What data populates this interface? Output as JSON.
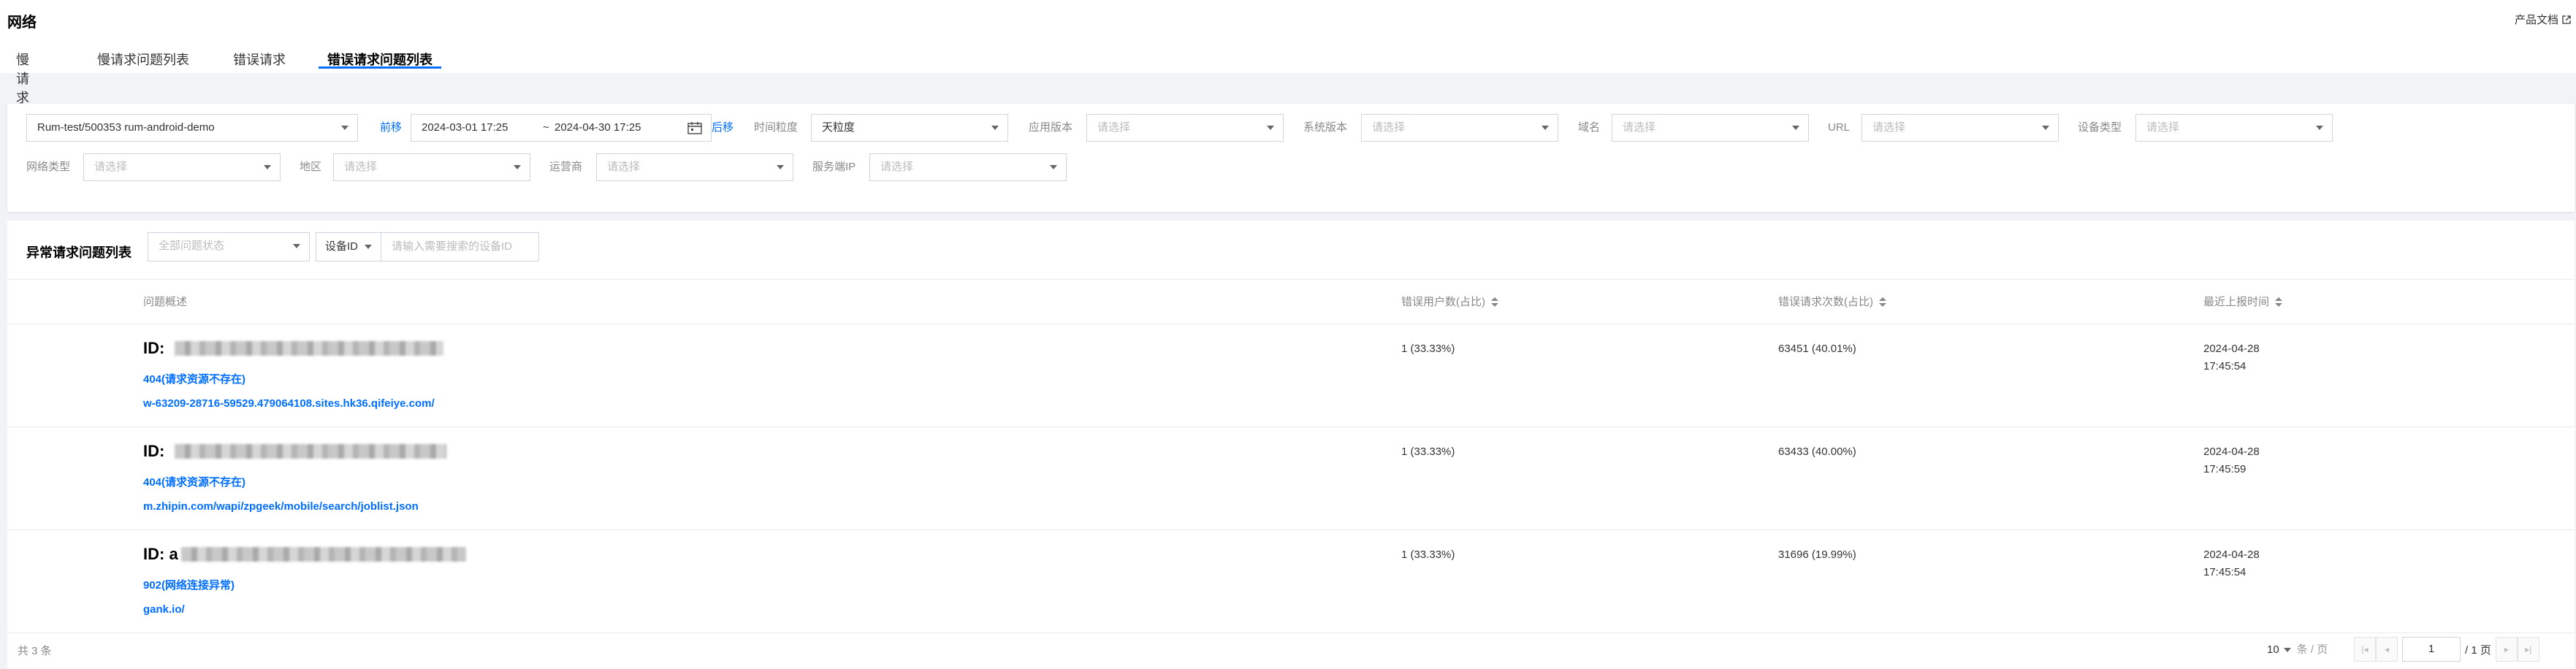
{
  "header": {
    "title": "网络",
    "doc_link": "产品文档"
  },
  "tabs": [
    {
      "label": "慢请求",
      "active": false
    },
    {
      "label": "慢请求问题列表",
      "active": false
    },
    {
      "label": "错误请求",
      "active": false
    },
    {
      "label": "错误请求问题列表",
      "active": true
    }
  ],
  "filters": {
    "project_value": "Rum-test/500353 rum-android-demo",
    "prev_label": "前移",
    "date_from": "2024-03-01 17:25",
    "date_sep": "~",
    "date_to": "2024-04-30 17:25",
    "next_label": "后移",
    "granularity_label": "时间粒度",
    "granularity_value": "天粒度",
    "app_version_label": "应用版本",
    "os_version_label": "系统版本",
    "domain_label": "域名",
    "url_label": "URL",
    "device_type_label": "设备类型",
    "network_type_label": "网络类型",
    "region_label": "地区",
    "carrier_label": "运营商",
    "server_ip_label": "服务端IP",
    "placeholder": "请选择"
  },
  "list": {
    "title": "异常请求问题列表",
    "status_placeholder": "全部问题状态",
    "search_key": "设备ID",
    "search_placeholder": "请输入需要搜索的设备ID",
    "columns": {
      "desc": "问题概述",
      "users": "错误用户数(占比)",
      "requests": "错误请求次数(占比)",
      "last_time": "最近上报时间"
    },
    "rows": [
      {
        "id_label": "ID:",
        "error": "404(请求资源不存在)",
        "url": "w-63209-28716-59529.479064108.sites.hk36.qifeiye.com/",
        "users": "1 (33.33%)",
        "requests": "63451 (40.01%)",
        "date": "2024-04-28",
        "time": "17:45:54"
      },
      {
        "id_label": "ID:",
        "error": "404(请求资源不存在)",
        "url": "m.zhipin.com/wapi/zpgeek/mobile/search/joblist.json",
        "users": "1 (33.33%)",
        "requests": "63433 (40.00%)",
        "date": "2024-04-28",
        "time": "17:45:59"
      },
      {
        "id_label": "ID: a",
        "error": "902(网络连接异常)",
        "url": "gank.io/",
        "users": "1 (33.33%)",
        "requests": "31696 (19.99%)",
        "date": "2024-04-28",
        "time": "17:45:54"
      }
    ],
    "footer": {
      "total": "共 3 条",
      "page_size": "10",
      "page_size_unit": "条 / 页",
      "current_page": "1",
      "total_pages": "/ 1 页"
    }
  },
  "colors": {
    "accent": "#006eff",
    "background": "#f2f3f7"
  }
}
